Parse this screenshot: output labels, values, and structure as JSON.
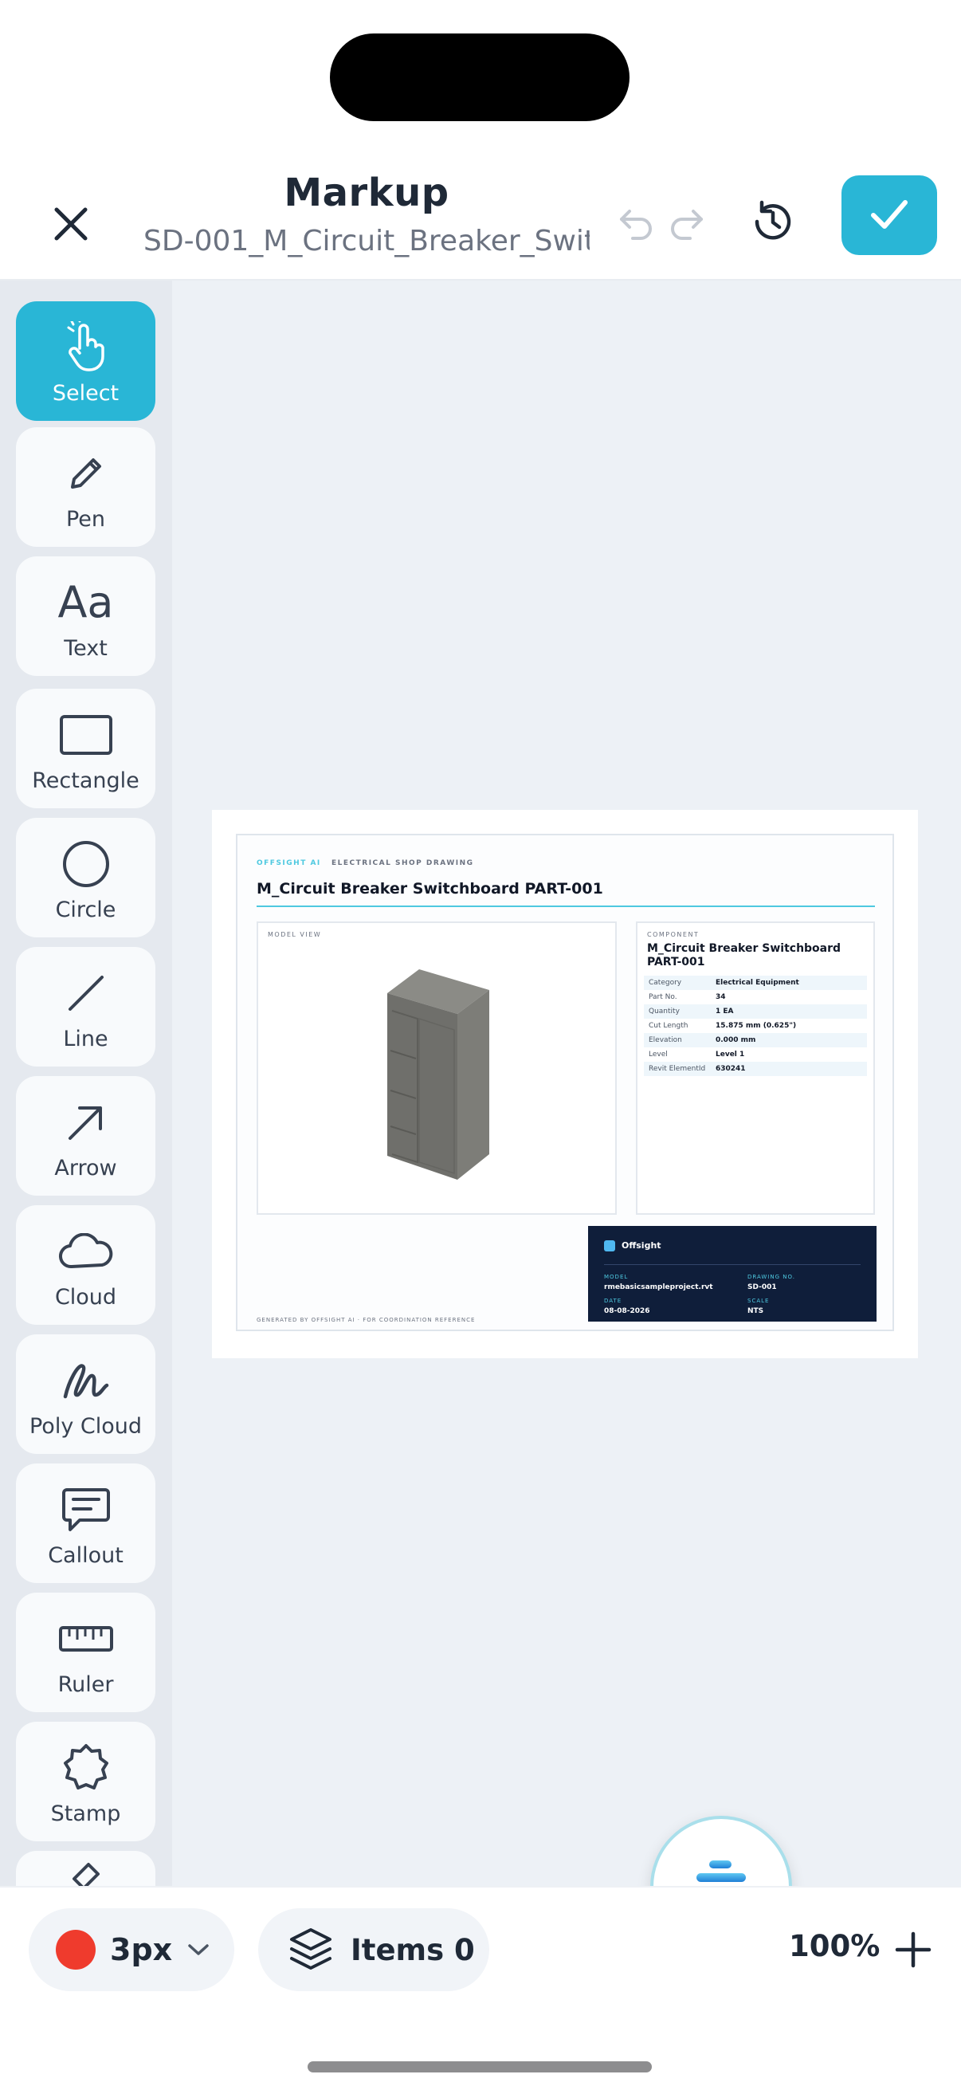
{
  "header": {
    "title": "Markup",
    "subtitle": "SD-001_M_Circuit_Breaker_Swit...",
    "accent": "#29b6d6"
  },
  "tools": [
    {
      "id": "select",
      "label": "Select",
      "icon": "hand-pointer-icon",
      "active": true
    },
    {
      "id": "pen",
      "label": "Pen",
      "icon": "pen-icon"
    },
    {
      "id": "text",
      "label": "Text",
      "icon": "text-aa-icon",
      "glyph": "Aa"
    },
    {
      "id": "rectangle",
      "label": "Rectangle",
      "icon": "rectangle-icon"
    },
    {
      "id": "circle",
      "label": "Circle",
      "icon": "circle-icon"
    },
    {
      "id": "line",
      "label": "Line",
      "icon": "line-icon"
    },
    {
      "id": "arrow",
      "label": "Arrow",
      "icon": "arrow-icon"
    },
    {
      "id": "cloud",
      "label": "Cloud",
      "icon": "cloud-icon"
    },
    {
      "id": "polycloud",
      "label": "Poly Cloud",
      "icon": "scribble-icon"
    },
    {
      "id": "callout",
      "label": "Callout",
      "icon": "speech-bubble-icon"
    },
    {
      "id": "ruler",
      "label": "Ruler",
      "icon": "ruler-icon"
    },
    {
      "id": "stamp",
      "label": "Stamp",
      "icon": "stamp-badge-icon"
    }
  ],
  "drawing": {
    "brand": "OFFSIGHT AI",
    "kind": "ELECTRICAL SHOP DRAWING",
    "title": "M_Circuit Breaker Switchboard  PART-001",
    "model_view_label": "MODEL VIEW",
    "component_label": "COMPONENT",
    "component_name": "M_Circuit Breaker Switchboard PART-001",
    "properties": [
      {
        "key": "Category",
        "value": "Electrical Equipment"
      },
      {
        "key": "Part No.",
        "value": "34"
      },
      {
        "key": "Quantity",
        "value": "1 EA"
      },
      {
        "key": "Cut Length",
        "value": "15.875 mm (0.625\")"
      },
      {
        "key": "Elevation",
        "value": "0.000 mm"
      },
      {
        "key": "Level",
        "value": "Level 1"
      },
      {
        "key": "Revit ElementId",
        "value": "630241"
      }
    ],
    "footer_note": "GENERATED BY OFFSIGHT AI · FOR COORDINATION REFERENCE",
    "titleblock": {
      "company": "Offsight",
      "model_label": "MODEL",
      "model_value": "rmebasicsampleproject.rvt",
      "drawing_no_label": "DRAWING NO.",
      "drawing_no_value": "SD-001",
      "date_label": "DATE",
      "date_value": "08-08-2026",
      "scale_label": "SCALE",
      "scale_value": "NTS"
    }
  },
  "bottom": {
    "stroke_color": "#ef3b2d",
    "stroke_width": "3px",
    "items_label": "Items 0",
    "zoom": "100%"
  }
}
